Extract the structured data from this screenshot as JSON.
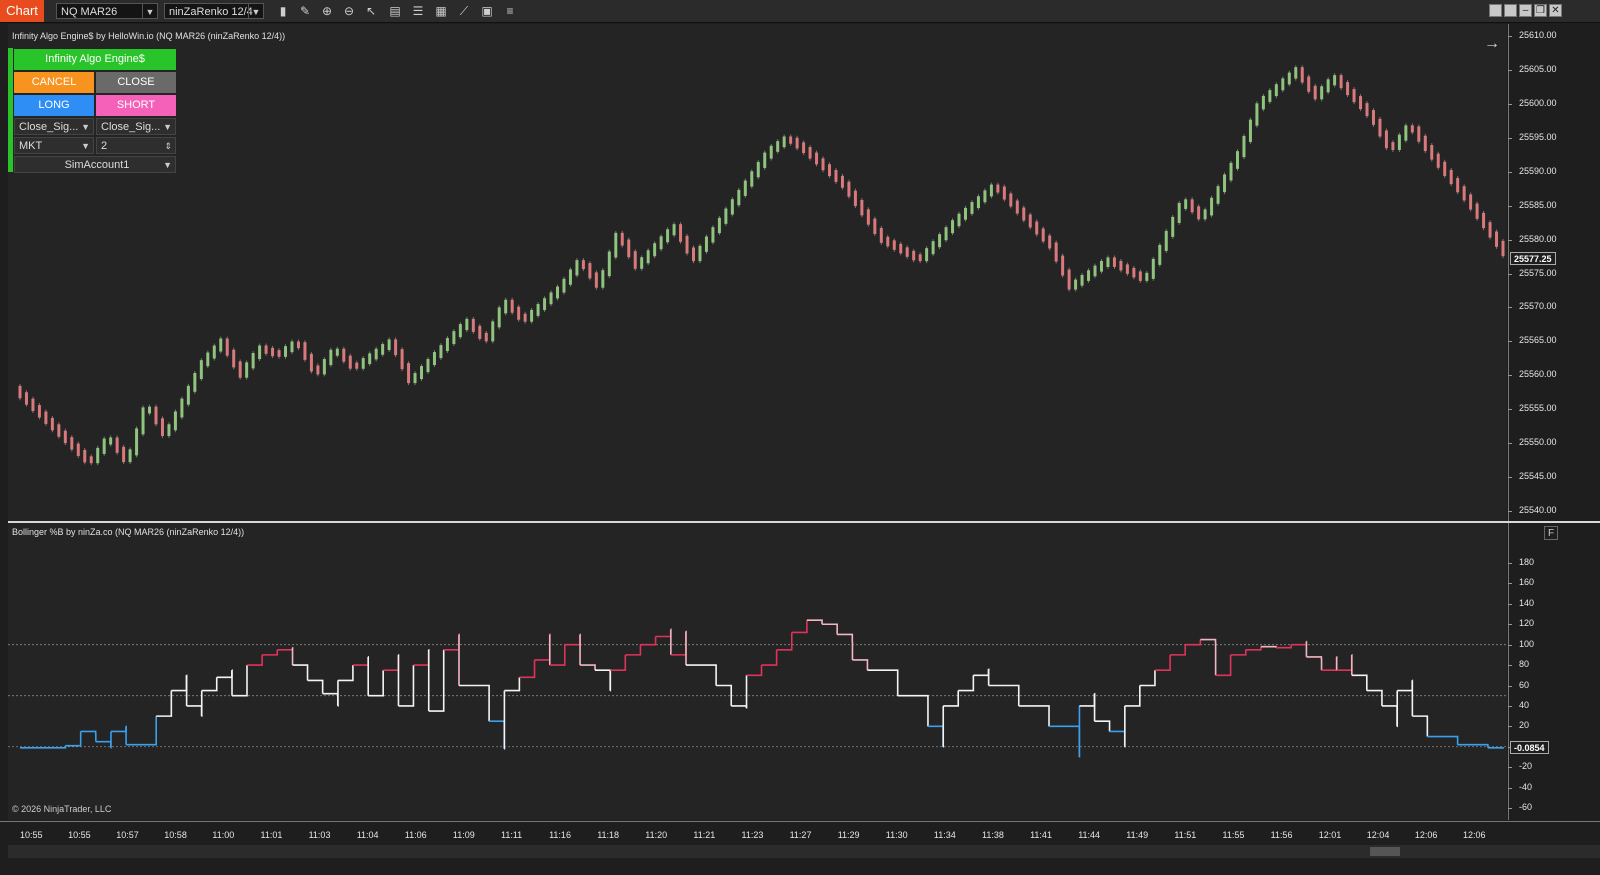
{
  "toolbar": {
    "tab_label": "Chart",
    "instrument": "NQ MAR26",
    "bar_type": "ninZaRenko 12/4",
    "icons": [
      "bar-chart-icon",
      "pencil-icon",
      "zoom-in-icon",
      "zoom-out-icon",
      "pointer-icon",
      "data-box-icon",
      "properties-icon",
      "templates-icon",
      "strategies-icon",
      "indicators-icon",
      "list-icon"
    ],
    "window_buttons": [
      "minimize-icon",
      "restore-icon",
      "maximize-icon",
      "close-icon"
    ]
  },
  "main_pane": {
    "title": "Infinity Algo Engine$ by HelloWin.io (NQ MAR26 (ninZaRenko 12/4))",
    "price_ticks": [
      "25610.00",
      "25605.00",
      "25600.00",
      "25595.00",
      "25590.00",
      "25585.00",
      "25580.00",
      "25575.00",
      "25570.00",
      "25565.00",
      "25560.00",
      "25555.00",
      "25550.00",
      "25545.00",
      "25540.00"
    ],
    "last_price": "25577.25"
  },
  "panel": {
    "header": "Infinity Algo Engine$",
    "cancel": "CANCEL",
    "close": "CLOSE",
    "long": "LONG",
    "short": "SHORT",
    "signal_left": "Close_Sig...",
    "signal_right": "Close_Sig...",
    "order_type": "MKT",
    "quantity": "2",
    "account": "SimAccount1",
    "colors": {
      "header": "#29c32a",
      "cancel": "#f7931e",
      "close": "#6a6a6a",
      "long": "#2e8ef5",
      "short": "#f560b8"
    }
  },
  "indicator_pane": {
    "title": "Bollinger %B by ninZa.co (NQ MAR26 (ninZaRenko 12/4))",
    "ticks": [
      "180",
      "160",
      "140",
      "120",
      "100",
      "80",
      "60",
      "40",
      "20",
      "0",
      "-20",
      "-40",
      "-60"
    ],
    "last_value": "-0.0854",
    "f_button": "F"
  },
  "x_axis": {
    "labels": [
      "10:55",
      "10:55",
      "10:57",
      "10:58",
      "11:00",
      "11:01",
      "11:03",
      "11:04",
      "11:06",
      "11:09",
      "11:11",
      "11:16",
      "11:18",
      "11:20",
      "11:21",
      "11:23",
      "11:27",
      "11:29",
      "11:30",
      "11:34",
      "11:38",
      "11:41",
      "11:44",
      "11:49",
      "11:51",
      "11:55",
      "11:56",
      "12:01",
      "12:04",
      "12:06",
      "12:06"
    ]
  },
  "copyright": "© 2026 NinjaTrader, LLC",
  "chart_data": {
    "type": "candlestick",
    "price_path": [
      [
        0,
        25558
      ],
      [
        4,
        25547
      ],
      [
        5,
        25551
      ],
      [
        6,
        25547
      ],
      [
        7,
        25556
      ],
      [
        8,
        25551
      ],
      [
        10,
        25562
      ],
      [
        11,
        25565
      ],
      [
        12,
        25560
      ],
      [
        13,
        25564
      ],
      [
        14,
        25563
      ],
      [
        15,
        25565
      ],
      [
        16,
        25560
      ],
      [
        17,
        25564
      ],
      [
        18,
        25561
      ],
      [
        20,
        25565
      ],
      [
        21,
        25559
      ],
      [
        22,
        25562
      ],
      [
        24,
        25568
      ],
      [
        25,
        25565
      ],
      [
        26,
        25571
      ],
      [
        27,
        25568
      ],
      [
        29,
        25573
      ],
      [
        30,
        25577
      ],
      [
        31,
        25573
      ],
      [
        32,
        25581
      ],
      [
        33,
        25576
      ],
      [
        35,
        25582
      ],
      [
        36,
        25577
      ],
      [
        38,
        25585
      ],
      [
        39,
        25589
      ],
      [
        40,
        25593
      ],
      [
        41,
        25595
      ],
      [
        42,
        25593
      ],
      [
        44,
        25588
      ],
      [
        45,
        25584
      ],
      [
        46,
        25580
      ],
      [
        48,
        25577
      ],
      [
        50,
        25583
      ],
      [
        52,
        25588
      ],
      [
        53,
        25585
      ],
      [
        55,
        25579
      ],
      [
        56,
        25573
      ],
      [
        58,
        25577
      ],
      [
        60,
        25574
      ],
      [
        61,
        25580
      ],
      [
        62,
        25586
      ],
      [
        63,
        25583
      ],
      [
        64,
        25588
      ],
      [
        65,
        25593
      ],
      [
        66,
        25600
      ],
      [
        68,
        25605
      ],
      [
        69,
        25601
      ],
      [
        70,
        25604
      ],
      [
        72,
        25598
      ],
      [
        73,
        25593
      ],
      [
        74,
        25597
      ],
      [
        75,
        25593
      ],
      [
        77,
        25586
      ],
      [
        79,
        25578
      ]
    ],
    "indicator": "Bollinger %B",
    "indicator_levels": [
      0,
      50,
      100
    ],
    "indicator_path": [
      [
        0,
        -1
      ],
      [
        3,
        1
      ],
      [
        4,
        2
      ],
      [
        4.01,
        15
      ],
      [
        5,
        12
      ],
      [
        5.01,
        5
      ],
      [
        6,
        -1
      ],
      [
        6.01,
        15
      ],
      [
        7,
        20
      ],
      [
        7.01,
        2
      ],
      [
        9,
        30
      ],
      [
        10,
        55
      ],
      [
        11,
        70
      ],
      [
        11.01,
        40
      ],
      [
        12,
        30
      ],
      [
        12.01,
        55
      ],
      [
        13,
        68
      ],
      [
        14,
        75
      ],
      [
        14.01,
        50
      ],
      [
        15,
        80
      ],
      [
        16,
        90
      ],
      [
        17,
        95
      ],
      [
        18,
        97
      ],
      [
        18.01,
        80
      ],
      [
        19,
        65
      ],
      [
        20,
        52
      ],
      [
        21,
        40
      ],
      [
        21.01,
        65
      ],
      [
        22,
        80
      ],
      [
        23,
        88
      ],
      [
        23.01,
        50
      ],
      [
        24,
        75
      ],
      [
        25,
        90
      ],
      [
        25.01,
        40
      ],
      [
        26,
        80
      ],
      [
        27,
        95
      ],
      [
        27.01,
        35
      ],
      [
        28,
        95
      ],
      [
        29,
        110
      ],
      [
        29.01,
        60
      ],
      [
        31,
        25
      ],
      [
        32,
        -2
      ],
      [
        32.01,
        55
      ],
      [
        33,
        68
      ],
      [
        34,
        85
      ],
      [
        35,
        110
      ],
      [
        35.01,
        80
      ],
      [
        36,
        100
      ],
      [
        37,
        110
      ],
      [
        37.01,
        80
      ],
      [
        38,
        75
      ],
      [
        39,
        55
      ],
      [
        39.01,
        75
      ],
      [
        40,
        90
      ],
      [
        41,
        100
      ],
      [
        42,
        108
      ],
      [
        43,
        115
      ],
      [
        43.01,
        90
      ],
      [
        44,
        113
      ],
      [
        44.01,
        80
      ],
      [
        46,
        60
      ],
      [
        47,
        40
      ],
      [
        48,
        38
      ],
      [
        48.01,
        70
      ],
      [
        49,
        80
      ],
      [
        50,
        95
      ],
      [
        51,
        112
      ],
      [
        52,
        124
      ],
      [
        53,
        120
      ],
      [
        54,
        110
      ],
      [
        55,
        102
      ],
      [
        55.01,
        85
      ],
      [
        56,
        75
      ],
      [
        58,
        50
      ],
      [
        60,
        20
      ],
      [
        61,
        0
      ],
      [
        61.01,
        40
      ],
      [
        62,
        55
      ],
      [
        63,
        70
      ],
      [
        64,
        76
      ],
      [
        64.01,
        60
      ],
      [
        66,
        40
      ],
      [
        68,
        20
      ],
      [
        70,
        -10
      ],
      [
        70.01,
        40
      ],
      [
        71,
        52
      ],
      [
        71.01,
        25
      ],
      [
        72,
        15
      ],
      [
        73,
        0
      ],
      [
        73.01,
        40
      ],
      [
        74,
        60
      ],
      [
        75,
        75
      ],
      [
        76,
        90
      ],
      [
        77,
        100
      ],
      [
        78,
        105
      ],
      [
        79,
        102
      ],
      [
        79.01,
        70
      ],
      [
        80,
        90
      ],
      [
        81,
        95
      ],
      [
        82,
        98
      ],
      [
        83,
        97
      ],
      [
        84,
        100
      ],
      [
        85,
        103
      ],
      [
        85.01,
        88
      ],
      [
        86,
        85
      ],
      [
        86.01,
        75
      ],
      [
        87,
        88
      ],
      [
        87.01,
        75
      ],
      [
        88,
        90
      ],
      [
        88.01,
        70
      ],
      [
        89,
        55
      ],
      [
        90,
        40
      ],
      [
        91,
        20
      ],
      [
        91.01,
        55
      ],
      [
        92,
        65
      ],
      [
        92.01,
        30
      ],
      [
        93,
        10
      ],
      [
        95,
        2
      ],
      [
        97,
        -1
      ],
      [
        98,
        -2
      ]
    ]
  }
}
